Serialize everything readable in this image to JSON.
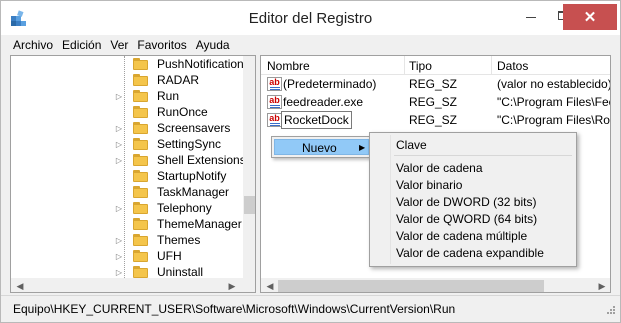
{
  "window": {
    "title": "Editor del Registro",
    "close_glyph": "✕"
  },
  "menu": [
    "Archivo",
    "Edición",
    "Ver",
    "Favoritos",
    "Ayuda"
  ],
  "tree": {
    "items": [
      {
        "label": "PushNotifications",
        "expander": ""
      },
      {
        "label": "RADAR",
        "expander": ""
      },
      {
        "label": "Run",
        "expander": "▷"
      },
      {
        "label": "RunOnce",
        "expander": ""
      },
      {
        "label": "Screensavers",
        "expander": "▷"
      },
      {
        "label": "SettingSync",
        "expander": "▷"
      },
      {
        "label": "Shell Extensions",
        "expander": "▷"
      },
      {
        "label": "StartupNotify",
        "expander": ""
      },
      {
        "label": "TaskManager",
        "expander": ""
      },
      {
        "label": "Telephony",
        "expander": "▷"
      },
      {
        "label": "ThemeManager",
        "expander": ""
      },
      {
        "label": "Themes",
        "expander": "▷"
      },
      {
        "label": "UFH",
        "expander": "▷"
      },
      {
        "label": "Uninstall",
        "expander": "▷"
      }
    ]
  },
  "values": {
    "columns": {
      "name": "Nombre",
      "type": "Tipo",
      "data": "Datos"
    },
    "rows": [
      {
        "name": "(Predeterminado)",
        "type": "REG_SZ",
        "data": "(valor no establecido)"
      },
      {
        "name": "feedreader.exe",
        "type": "REG_SZ",
        "data": "\"C:\\Program Files\\Feed"
      },
      {
        "name": "RocketDock",
        "type": "REG_SZ",
        "data": "\"C:\\Program Files\\Rock"
      }
    ]
  },
  "context_menu": {
    "item": "Nuevo",
    "submenu": [
      "Clave",
      "Valor de cadena",
      "Valor binario",
      "Valor de DWORD (32 bits)",
      "Valor de QWORD (64 bits)",
      "Valor de cadena múltiple",
      "Valor de cadena expandible"
    ]
  },
  "status": {
    "path": "Equipo\\HKEY_CURRENT_USER\\Software\\Microsoft\\Windows\\CurrentVersion\\Run"
  },
  "colors": {
    "close_button": "#c75050",
    "menu_highlight": "#91c9f7",
    "folder": "#f4c54b"
  }
}
